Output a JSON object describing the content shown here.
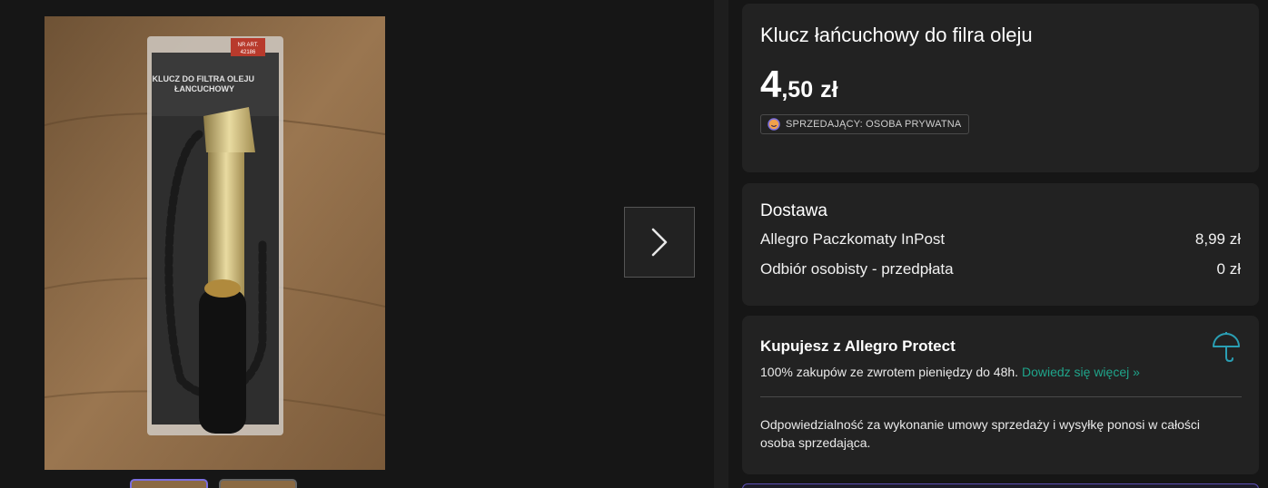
{
  "product": {
    "title": "Klucz łańcuchowy do filra oleju",
    "price_int": "4",
    "price_frac": ",50",
    "price_currency": "zł",
    "seller_badge": "SPRZEDAJĄCY: OSOBA PRYWATNA"
  },
  "delivery": {
    "heading": "Dostawa",
    "options": [
      {
        "name": "Allegro Paczkomaty InPost",
        "price": "8,99 zł"
      },
      {
        "name": "Odbiór osobisty - przedpłata",
        "price": "0 zł"
      }
    ]
  },
  "protect": {
    "heading": "Kupujesz z Allegro Protect",
    "line": "100% zakupów ze zwrotem pieniędzy do 48h.",
    "link": "Dowiedz się więcej »",
    "note": "Odpowiedzialność za wykonanie umowy sprzedaży i wysyłkę ponosi w całości osoba sprzedająca."
  },
  "packaging_text": {
    "header": "KLUCZ DO FILTRA OLEJU ŁANCUCHOWY",
    "art": "NR ART. 42186"
  },
  "colors": {
    "accent_link": "#1fa58b",
    "umbrella": "#2a9fb4",
    "thumb_active_border": "#7b6fe0"
  },
  "icons": {
    "next": "chevron-right-icon",
    "umbrella": "umbrella-icon",
    "seller": "smiley-icon"
  }
}
